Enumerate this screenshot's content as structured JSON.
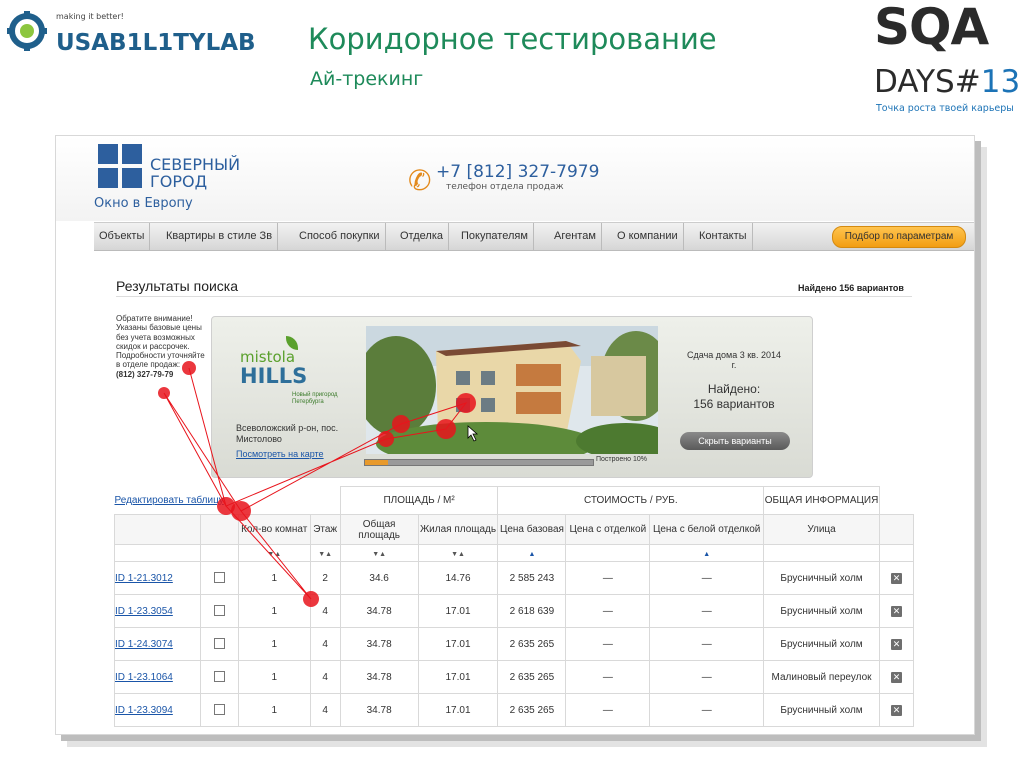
{
  "slide": {
    "brand_tagline": "making it better!",
    "brand_word": "USAB1L1TYLAB",
    "title": "Коридорное тестирование",
    "subtitle": "Ай-трекинг",
    "sqa_line1": "SQA",
    "sqa_line2": "DAYS#",
    "sqa_number": "13",
    "sqa_tagline": "Точка роста твоей карьеры"
  },
  "site": {
    "logo_line1": "СЕВЕРНЫЙ",
    "logo_line2": "ГОРОД",
    "slogan": "Окно в Европу",
    "phone": "+7 [812] 327-7979",
    "phone_caption": "телефон отдела продаж",
    "nav": [
      "Объекты",
      "Квартиры в стиле Зв",
      "Способ покупки",
      "Отделка",
      "Покупателям",
      "Агентам",
      "О компании",
      "Контакты"
    ],
    "nav_button": "Подбор по параметрам"
  },
  "results": {
    "title": "Результаты поиска",
    "found_text": "Найдено 156 вариантов",
    "notice": "Обратите внимание! Указаны базовые цены без учета возможных скидок и рассрочек. Подробности уточняйте в отделе продаж:",
    "notice_phone": "(812) 327-79-79"
  },
  "banner": {
    "brand1": "mistola",
    "brand2": "HILLS",
    "brand_small": "Новый пригород Петербурга",
    "address": "Всеволожский р-он, пос. Мистолово",
    "map_link": "Посмотреть на карте",
    "progress_label": "Построено 10%",
    "progress_fraction": 0.1,
    "delivery": "Сдача дома 3 кв. 2014 г.",
    "found_label": "Найдено:",
    "found_count": "156 вариантов",
    "hide_button": "Скрыть варианты"
  },
  "table": {
    "edit_link": "Редактировать таблицу",
    "group_area": "ПЛОЩАДЬ / М²",
    "group_cost": "СТОИМОСТЬ / РУБ.",
    "group_info": "ОБЩАЯ ИНФОРМАЦИЯ",
    "col_rooms": "Кол-во комнат",
    "col_floor": "Этаж",
    "col_total": "Общая площадь",
    "col_living": "Жилая площадь",
    "col_base": "Цена базовая",
    "col_finish": "Цена с отделкой",
    "col_white": "Цена с белой отделкой",
    "col_street": "Улица",
    "sort_both": "▼▲",
    "sort_up": "▲",
    "rows": [
      {
        "id": "ID 1-21.3012",
        "rooms": "1",
        "floor": "2",
        "total": "34.6",
        "living": "14.76",
        "price": "2 585 243",
        "p2": "—",
        "p3": "—",
        "street": "Брусничный холм"
      },
      {
        "id": "ID 1-23.3054",
        "rooms": "1",
        "floor": "4",
        "total": "34.78",
        "living": "17.01",
        "price": "2 618 639",
        "p2": "—",
        "p3": "—",
        "street": "Брусничный холм"
      },
      {
        "id": "ID 1-24.3074",
        "rooms": "1",
        "floor": "4",
        "total": "34.78",
        "living": "17.01",
        "price": "2 635 265",
        "p2": "—",
        "p3": "—",
        "street": "Брусничный холм"
      },
      {
        "id": "ID 1-23.1064",
        "rooms": "1",
        "floor": "4",
        "total": "34.78",
        "living": "17.01",
        "price": "2 635 265",
        "p2": "—",
        "p3": "—",
        "street": "Малиновый переулок"
      },
      {
        "id": "ID 1-23.3094",
        "rooms": "1",
        "floor": "4",
        "total": "34.78",
        "living": "17.01",
        "price": "2 635 265",
        "p2": "—",
        "p3": "—",
        "street": "Брусничный холм"
      }
    ]
  },
  "colors": {
    "title_green": "#1e8a5a",
    "brand_blue": "#2d5f9e",
    "gaze_red": "#e8141c",
    "nav_orange": "#f29d12"
  }
}
